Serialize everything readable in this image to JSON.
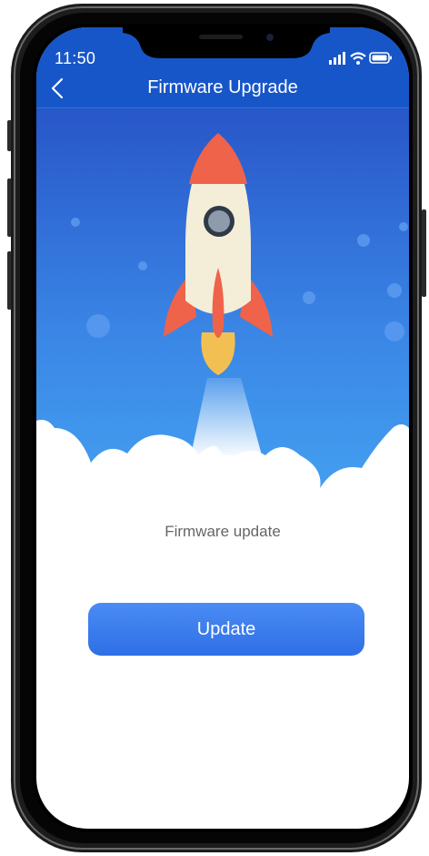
{
  "status_bar": {
    "time": "11:50",
    "signal_icon": "cellular-signal-icon",
    "wifi_icon": "wifi-icon",
    "battery_icon": "battery-icon"
  },
  "nav": {
    "back_icon": "chevron-left-icon",
    "title": "Firmware Upgrade"
  },
  "hero": {
    "illustration": "rocket-launch-illustration"
  },
  "content": {
    "message": "Firmware update",
    "button_label": "Update"
  },
  "colors": {
    "header_blue": "#1a56c4",
    "sky_top": "#2a52c9",
    "sky_bottom": "#3fa0f0",
    "button_blue": "#3b7cf0",
    "rocket_body": "#f3edd8",
    "rocket_fins": "#f0654a",
    "flame": "#f3c257"
  }
}
